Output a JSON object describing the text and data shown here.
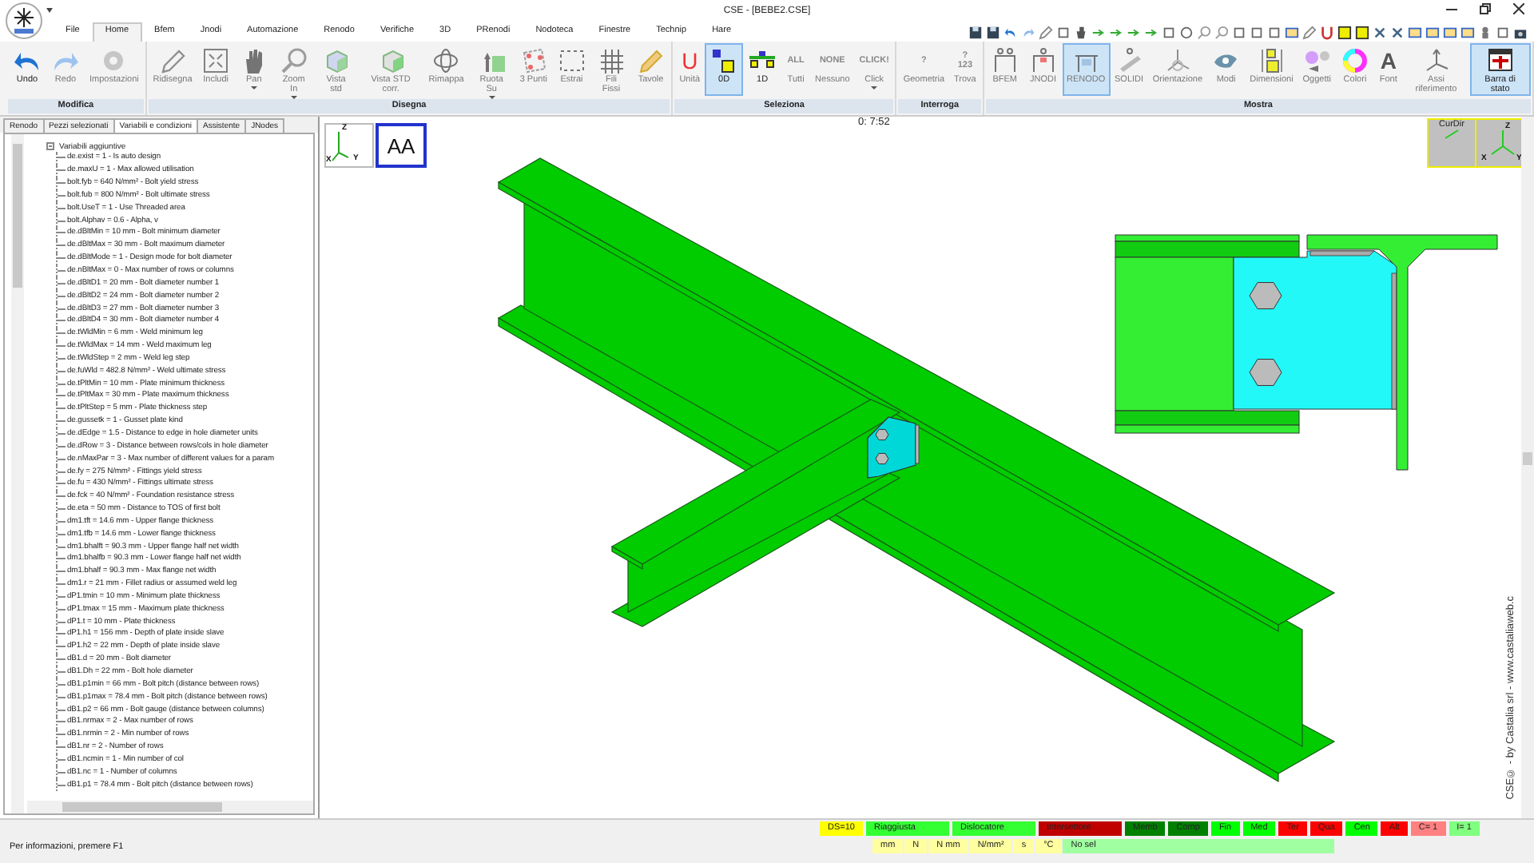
{
  "window": {
    "title": "CSE - [BEBE2.CSE]"
  },
  "menu_tabs": [
    {
      "label": "File",
      "selected": false
    },
    {
      "label": "Home",
      "selected": true
    },
    {
      "label": "Bfem",
      "selected": false
    },
    {
      "label": "Jnodi",
      "selected": false
    },
    {
      "label": "Automazione",
      "selected": false
    },
    {
      "label": "Renodo",
      "selected": false
    },
    {
      "label": "Verifiche",
      "selected": false
    },
    {
      "label": "3D",
      "selected": false
    },
    {
      "label": "PRenodi",
      "selected": false
    },
    {
      "label": "Nodoteca",
      "selected": false
    },
    {
      "label": "Finestre",
      "selected": false
    },
    {
      "label": "Technip",
      "selected": false
    },
    {
      "label": "Hare",
      "selected": false
    }
  ],
  "ribbon": [
    {
      "label": "Modifica",
      "buttons": [
        {
          "label": "Undo",
          "disabled": false,
          "selected": false
        },
        {
          "label": "Redo",
          "disabled": true,
          "selected": false
        },
        {
          "label": "Impostazioni",
          "disabled": true,
          "selected": false
        }
      ]
    },
    {
      "label": "Disegna",
      "buttons": [
        {
          "label": "Ridisegna",
          "disabled": true,
          "selected": false
        },
        {
          "label": "Includi",
          "disabled": true,
          "selected": false
        },
        {
          "label": "Pan",
          "disabled": true,
          "selected": false,
          "caret": true
        },
        {
          "label": "Zoom In",
          "disabled": true,
          "selected": false,
          "caret": true
        },
        {
          "label": "Vista std",
          "disabled": true,
          "selected": false
        },
        {
          "label": "Vista STD corr.",
          "disabled": true,
          "selected": false
        },
        {
          "label": "Rimappa",
          "disabled": true,
          "selected": false
        },
        {
          "label": "Ruota Su",
          "disabled": true,
          "selected": false,
          "caret": true
        },
        {
          "label": "3 Punti",
          "disabled": true,
          "selected": false
        },
        {
          "label": "Estrai",
          "disabled": true,
          "selected": false
        },
        {
          "label": "Fili Fissi",
          "disabled": true,
          "selected": false
        },
        {
          "label": "Tavole",
          "disabled": true,
          "selected": false
        }
      ]
    },
    {
      "label": "Seleziona",
      "buttons": [
        {
          "label": "Unità",
          "disabled": true,
          "selected": false,
          "icon_text": "U"
        },
        {
          "label": "0D",
          "disabled": false,
          "selected": true
        },
        {
          "label": "1D",
          "disabled": false,
          "selected": false
        },
        {
          "label": "Tutti",
          "disabled": true,
          "selected": false,
          "icon_text": "ALL"
        },
        {
          "label": "Nessuno",
          "disabled": true,
          "selected": false,
          "icon_text": "NONE"
        },
        {
          "label": "Click",
          "disabled": true,
          "selected": false,
          "icon_text": "CLICK!",
          "caret": true
        }
      ]
    },
    {
      "label": "Interroga",
      "buttons": [
        {
          "label": "Geometria",
          "disabled": true,
          "selected": false,
          "icon_text": "?"
        },
        {
          "label": "Trova",
          "disabled": true,
          "selected": false,
          "icon_text": "? 123"
        }
      ]
    },
    {
      "label": "Mostra",
      "buttons": [
        {
          "label": "BFEM",
          "disabled": true,
          "selected": false
        },
        {
          "label": "JNODI",
          "disabled": true,
          "selected": false
        },
        {
          "label": "RENODO",
          "disabled": true,
          "selected": true
        },
        {
          "label": "SOLIDI",
          "disabled": true,
          "selected": false
        },
        {
          "label": "Orientazione",
          "disabled": true,
          "selected": false
        },
        {
          "label": "Modi",
          "disabled": true,
          "selected": false
        },
        {
          "label": "Dimensioni",
          "disabled": true,
          "selected": false
        },
        {
          "label": "Oggetti",
          "disabled": true,
          "selected": false
        },
        {
          "label": "Colori",
          "disabled": true,
          "selected": false
        },
        {
          "label": "Font",
          "disabled": true,
          "selected": false,
          "icon_text": "A"
        },
        {
          "label": "Assi riferimento",
          "disabled": true,
          "selected": false
        },
        {
          "label": "Barra di stato",
          "disabled": false,
          "selected": true
        }
      ]
    }
  ],
  "panel_tabs": [
    {
      "label": "Renodo",
      "selected": false
    },
    {
      "label": "Pezzi selezionati",
      "selected": false
    },
    {
      "label": "Variabili e condizioni",
      "selected": true
    },
    {
      "label": "Assistente",
      "selected": false
    },
    {
      "label": "JNodes",
      "selected": false
    }
  ],
  "tree": {
    "label": "Variabili aggiuntive",
    "expanded": true,
    "children": [
      {
        "label": "de.exist = 1  -  Is auto design"
      },
      {
        "label": "de.maxU = 1  -  Max allowed utilisation"
      },
      {
        "label": "bolt.fyb = 640 N/mm²  -  Bolt yield stress"
      },
      {
        "label": "bolt.fub = 800 N/mm²  -  Bolt ultimate stress"
      },
      {
        "label": "bolt.UseT = 1  -  Use Threaded area"
      },
      {
        "label": "bolt.Alphav = 0.6  -  Alpha, v"
      },
      {
        "label": "de.dBltMin = 10 mm  -  Bolt minimum diameter"
      },
      {
        "label": "de.dBltMax = 30 mm  -  Bolt maximum diameter"
      },
      {
        "label": "de.dBltMode = 1  -  Design mode for bolt diameter"
      },
      {
        "label": "de.nBltMax = 0  -  Max number of rows or columns"
      },
      {
        "label": "de.dBltD1 = 20 mm  -  Bolt diameter number 1"
      },
      {
        "label": "de.dBltD2 = 24 mm  -  Bolt diameter number 2"
      },
      {
        "label": "de.dBltD3 = 27 mm  -  Bolt diameter number 3"
      },
      {
        "label": "de.dBltD4 = 30 mm  -  Bolt diameter number 4"
      },
      {
        "label": "de.tWldMin = 6 mm  -  Weld minimum leg"
      },
      {
        "label": "de.tWldMax = 14 mm  -  Weld maximum leg"
      },
      {
        "label": "de.tWldStep = 2 mm  -  Weld leg step"
      },
      {
        "label": "de.fuWld = 482.8 N/mm²  -  Weld ultimate stress"
      },
      {
        "label": "de.tPltMin = 10 mm  -  Plate minimum thickness"
      },
      {
        "label": "de.tPltMax = 30 mm  -  Plate maximum thickness"
      },
      {
        "label": "de.tPltStep = 5 mm  -  Plate thickness step"
      },
      {
        "label": "de.gussetk = 1  -  Gusset plate kind"
      },
      {
        "label": "de.dEdge = 1.5  -  Distance to edge in hole diameter units"
      },
      {
        "label": "de.dRow = 3  -  Distance between rows/cols in hole diameter"
      },
      {
        "label": "de.nMaxPar = 3  -  Max number of different values for a param"
      },
      {
        "label": "de.fy = 275 N/mm²  -  Fittings yield stress"
      },
      {
        "label": "de.fu = 430 N/mm²  -  Fittings ultimate stress"
      },
      {
        "label": "de.fck = 40 N/mm²  -  Foundation resistance stress"
      },
      {
        "label": "de.eta = 50 mm  -  Distance to TOS of first bolt"
      },
      {
        "label": "dm1.tft = 14.6 mm  -  Upper flange thickness"
      },
      {
        "label": "dm1.tfb = 14.6 mm  -  Lower flange thickness"
      },
      {
        "label": "dm1.bhalft = 90.3 mm  -  Upper flange half net width"
      },
      {
        "label": "dm1.bhalfb = 90.3 mm  -  Lower flange half net width"
      },
      {
        "label": "dm1.bhalf = 90.3 mm  -  Max flange net width"
      },
      {
        "label": "dm1.r = 21 mm  -  Fillet radius or assumed weld leg"
      },
      {
        "label": "dP1.tmin = 10 mm  -  Minimum plate thickness"
      },
      {
        "label": "dP1.tmax = 15 mm  -  Maximum plate thickness"
      },
      {
        "label": "dP1.t = 10 mm  -  Plate thickness"
      },
      {
        "label": "dP1.h1 = 156 mm  -  Depth of plate inside slave"
      },
      {
        "label": "dP1.h2 = 22 mm  -  Depth of plate inside slave"
      },
      {
        "label": "dB1.d = 20 mm  -  Bolt diameter"
      },
      {
        "label": "dB1.Dh = 22 mm  -  Bolt hole diameter"
      },
      {
        "label": "dB1.p1min = 66 mm  -  Bolt pitch (distance between rows)"
      },
      {
        "label": "dB1.p1max = 78.4 mm  -  Bolt pitch (distance between rows)"
      },
      {
        "label": "dB1.p2 = 66 mm  -  Bolt gauge (distance between columns)"
      },
      {
        "label": "dB1.nrmax = 2  -  Max number of rows"
      },
      {
        "label": "dB1.nrmin = 2  -  Min number of rows"
      },
      {
        "label": "dB1.nr = 2  -  Number of rows"
      },
      {
        "label": "dB1.ncmin = 1  -  Min number of col"
      },
      {
        "label": "dB1.nc = 1  -  Number of columns"
      },
      {
        "label": "dB1.p1 = 78.4 mm  -  Bolt pitch (distance between rows)"
      }
    ]
  },
  "viewport": {
    "view_axes": [
      "Z",
      "X",
      "Y"
    ],
    "view_label": "AA",
    "clock": "0: 7:52",
    "curdir_label": "CurDir",
    "corner_axes": [
      "Z",
      "X",
      "Y"
    ],
    "credit": "CSE© - by Castalia srl - www.castaliaweb.c"
  },
  "status_bar": {
    "flags": [
      {
        "label": "DS=10",
        "color": "#ffff00"
      },
      {
        "label": "Riaggiusta",
        "color": "#33ff33"
      },
      {
        "label": "Dislocatore",
        "color": "#33ff33"
      },
      {
        "label": "Intersettore",
        "color": "#c00000"
      },
      {
        "label": "Memb",
        "color": "#008000"
      },
      {
        "label": "Comp",
        "color": "#008000"
      },
      {
        "label": "Fin",
        "color": "#00ff00"
      },
      {
        "label": "Med",
        "color": "#00ff00"
      },
      {
        "label": "Ter",
        "color": "#ff0000"
      },
      {
        "label": "Qua",
        "color": "#ff0000"
      },
      {
        "label": "Cen",
        "color": "#00ff00"
      },
      {
        "label": "Alt",
        "color": "#ff0000"
      },
      {
        "label": "C=  1",
        "color": "#ff8080"
      },
      {
        "label": "I=  1",
        "color": "#80ff80"
      }
    ],
    "message": "Per informazioni, premere F1",
    "units": [
      {
        "label": "mm",
        "color": "#ffffa0"
      },
      {
        "label": "N",
        "color": "#ffffa0"
      },
      {
        "label": "N mm",
        "color": "#ffffa0"
      },
      {
        "label": "N/mm²",
        "color": "#ffffa0"
      },
      {
        "label": "s",
        "color": "#ffffa0"
      },
      {
        "label": "°C",
        "color": "#ffffa0"
      },
      {
        "label": "No sel",
        "color": "#a0ffa0"
      }
    ]
  }
}
